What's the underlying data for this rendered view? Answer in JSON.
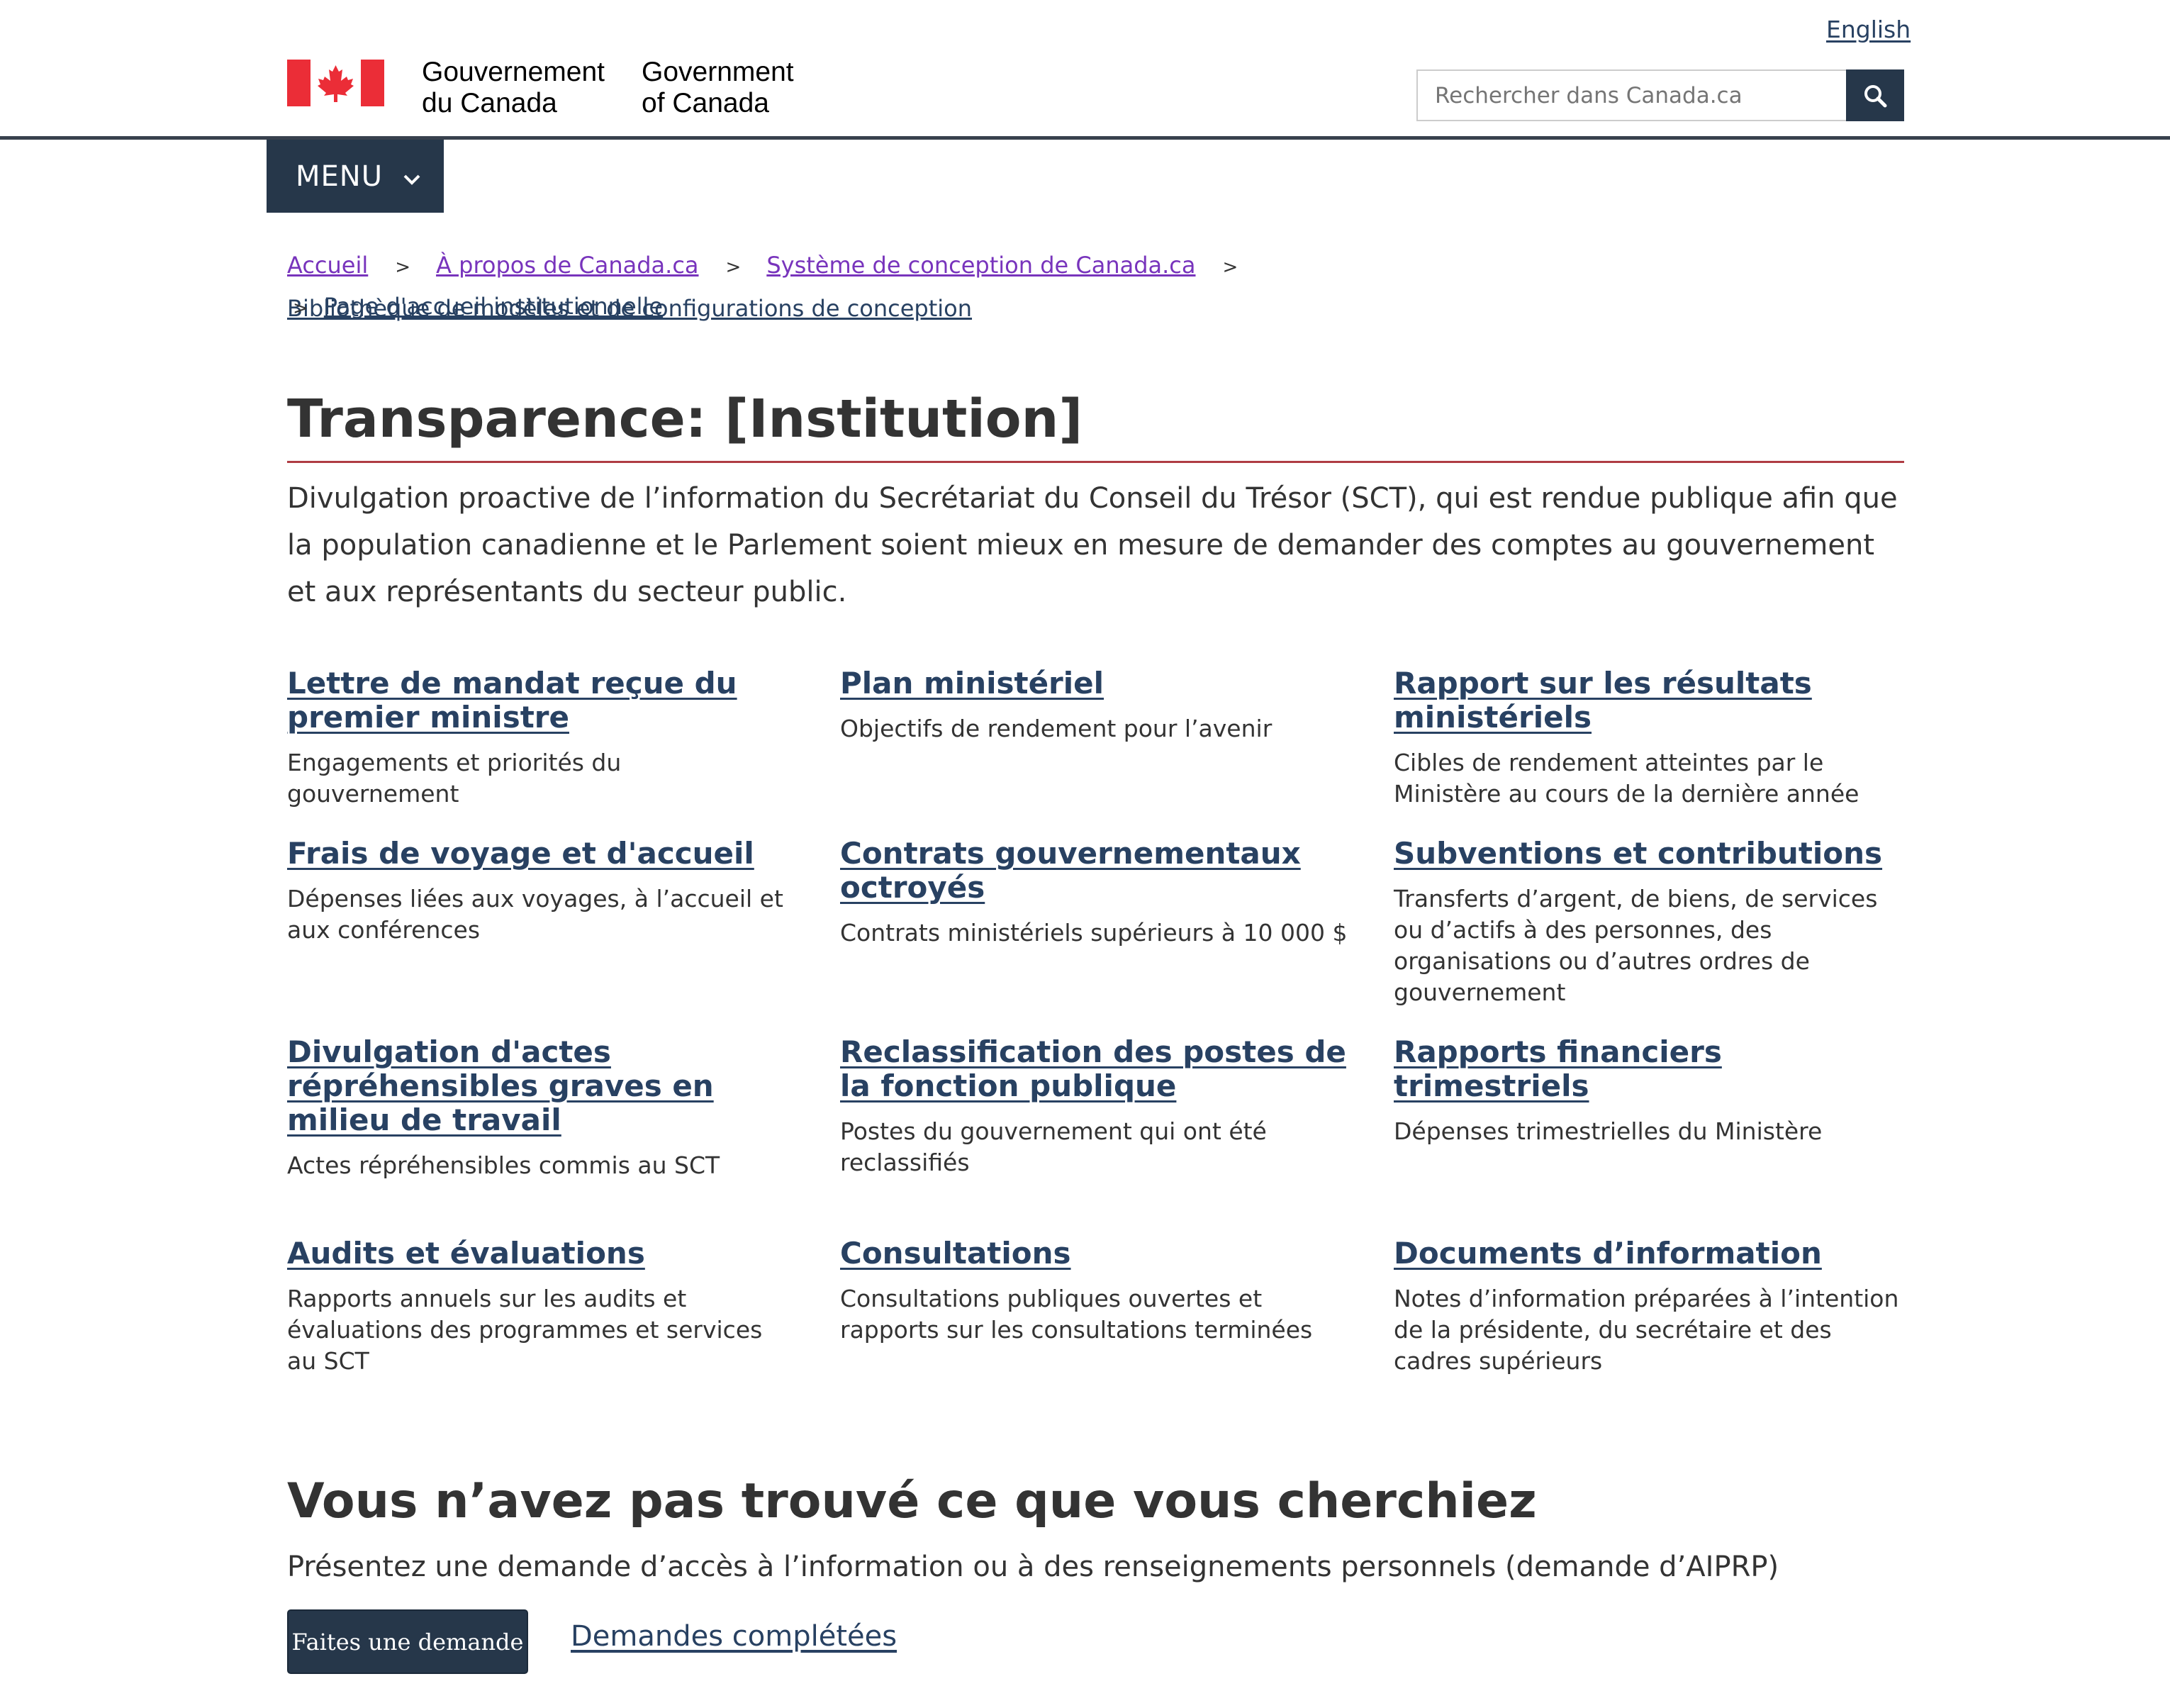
{
  "header": {
    "language_toggle": "English",
    "signature_fr_line1": "Gouvernement",
    "signature_fr_line2": "du Canada",
    "signature_en_line1": "Government",
    "signature_en_line2": "of Canada",
    "search_placeholder": "Rechercher dans Canada.ca",
    "flag_color": "#eb2d37"
  },
  "menu": {
    "label": "MENU"
  },
  "breadcrumb": [
    {
      "label": "Accueil"
    },
    {
      "label": "À propos de Canada.ca"
    },
    {
      "label": "Système de conception de Canada.ca"
    },
    {
      "label": "Bibliothèque de modèles et de configurations de conception"
    },
    {
      "label": "Page d'accueil institutionnelle"
    }
  ],
  "breadcrumb_separator": ">",
  "page": {
    "title": "Transparence: [Institution]",
    "intro": "Divulgation proactive de l’information du Secrétariat du Conseil du Trésor (SCT), qui est rendue publique afin que la population canadienne et le Parlement soient mieux en mesure de demander des comptes au gouvernement et aux représentants du secteur public."
  },
  "cards": [
    {
      "title": "Lettre de mandat reçue du premier ministre",
      "desc": "Engagements et priorités du gouvernement"
    },
    {
      "title": "Plan ministériel",
      "desc": "Objectifs de rendement pour l’avenir"
    },
    {
      "title": "Rapport sur les résultats ministériels",
      "desc": "Cibles de rendement atteintes par le Ministère au cours de la dernière année"
    },
    {
      "title": "Frais de voyage et d'accueil",
      "desc": "Dépenses liées aux voyages, à l’accueil et aux conférences"
    },
    {
      "title": "Contrats gouvernementaux octroyés",
      "desc": "Contrats ministériels supérieurs à 10 000 $"
    },
    {
      "title": "Subventions et contributions",
      "desc": "Transferts d’argent, de biens, de services ou d’actifs à des personnes, des organisations ou d’autres ordres de gouvernement"
    },
    {
      "title": "Divulgation d'actes répréhensibles graves en milieu de travail",
      "desc": "Actes répréhensibles commis au SCT"
    },
    {
      "title": "Reclassification des postes de la fonction publique",
      "desc": "Postes du gouvernement qui ont été reclassifiés"
    },
    {
      "title": "Rapports financiers trimestriels",
      "desc": "Dépenses trimestrielles du Ministère"
    },
    {
      "title": "Audits et évaluations",
      "desc": "Rapports annuels sur les audits et évaluations des programmes et services au SCT"
    },
    {
      "title": "Consultations",
      "desc": "Consultations publiques ouvertes et rapports sur les consultations terminées"
    },
    {
      "title": "Documents d’information",
      "desc": "Notes d’information préparées à l’intention de la présidente, du secrétaire et des cadres supérieurs"
    }
  ],
  "footer_section": {
    "heading": "Vous n’avez pas trouvé ce que vous cherchiez",
    "text": "Présentez une demande d’accès à l’information ou à des renseignements personnels (demande d’AIPRP)",
    "primary_button": "Faites une demande",
    "secondary_link": "Demandes complétées"
  }
}
